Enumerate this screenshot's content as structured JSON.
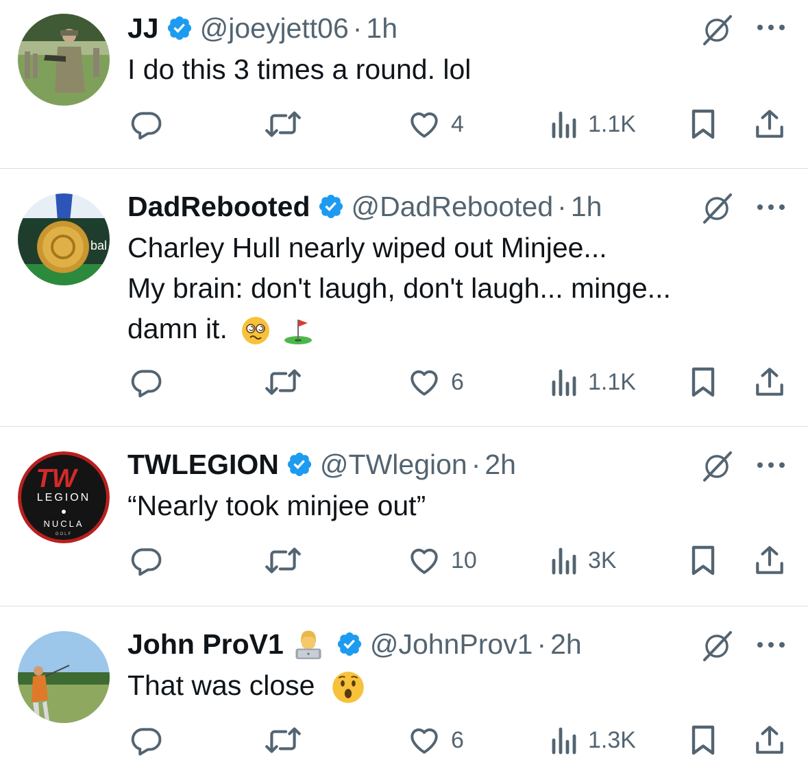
{
  "colors": {
    "text": "#0f1419",
    "secondary": "#536471",
    "verified": "#1d9bf0",
    "divider": "#d9dde1"
  },
  "tweets": [
    {
      "name": "JJ",
      "verified": true,
      "handle": "@joeyjett06",
      "dot": "·",
      "time": "1h",
      "lines": [
        "I do this 3 times a round. lol"
      ],
      "likes": "4",
      "views": "1.1K",
      "avatar": "soldier-photo"
    },
    {
      "name": "DadRebooted",
      "verified": true,
      "handle": "@DadRebooted",
      "dot": "·",
      "time": "1h",
      "lines": [
        "Charley Hull nearly wiped out Minjee...",
        "My brain: don't laugh, don't laugh... minge...",
        "damn it."
      ],
      "emojis": [
        "dizzy-face-emoji",
        "golf-flag-emoji"
      ],
      "likes": "6",
      "views": "1.1K",
      "avatar": "medal-photo"
    },
    {
      "name": "TWLEGION",
      "verified": true,
      "handle": "@TWlegion",
      "dot": "·",
      "time": "2h",
      "lines": [
        "“Nearly took minjee out”"
      ],
      "likes": "10",
      "views": "3K",
      "avatar": "tw-legion-logo",
      "logo_text": {
        "top": "TW",
        "mid": "LEGION",
        "bottom": "NUCLA",
        "tiny": "GOLF"
      }
    },
    {
      "name": "John ProV1",
      "name_emoji": "technologist-emoji",
      "verified": true,
      "handle": "@JohnProv1",
      "dot": "·",
      "time": "2h",
      "lines": [
        "That was close"
      ],
      "emojis": [
        "hushed-face-emoji"
      ],
      "likes": "6",
      "views": "1.3K",
      "avatar": "golfer-photo"
    }
  ]
}
